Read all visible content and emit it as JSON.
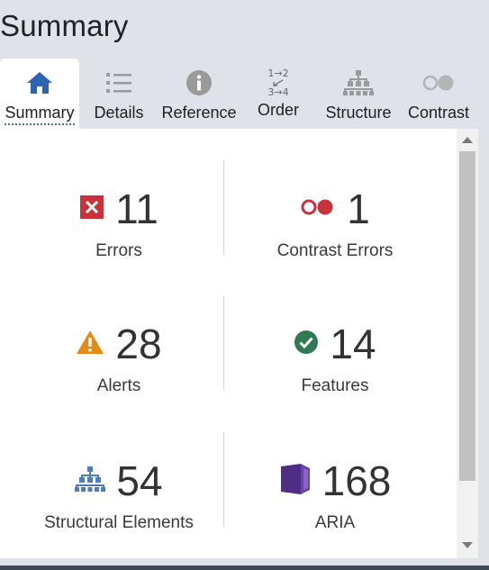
{
  "page_title": "Summary",
  "tabs": [
    {
      "label": "Summary",
      "icon": "home-icon",
      "active": true
    },
    {
      "label": "Details",
      "icon": "list-icon",
      "active": false
    },
    {
      "label": "Reference",
      "icon": "info-icon",
      "active": false
    },
    {
      "label": "Order",
      "icon": "order-icon",
      "active": false
    },
    {
      "label": "Structure",
      "icon": "structure-icon",
      "active": false
    },
    {
      "label": "Contrast",
      "icon": "contrast-icon",
      "active": false
    }
  ],
  "order_icon_text": {
    "top": "1→2",
    "bottom": "3→4"
  },
  "stats": {
    "errors": {
      "value": "11",
      "label": "Errors",
      "icon": "error-icon",
      "color": "#c8323a"
    },
    "contrast_errors": {
      "value": "1",
      "label": "Contrast Errors",
      "icon": "contrast-error-icon",
      "color": "#c8323a"
    },
    "alerts": {
      "value": "28",
      "label": "Alerts",
      "icon": "alert-icon",
      "color": "#e58a14"
    },
    "features": {
      "value": "14",
      "label": "Features",
      "icon": "feature-icon",
      "color": "#2f7a52"
    },
    "structural_elements": {
      "value": "54",
      "label": "Structural Elements",
      "icon": "structure-icon",
      "color": "#4a7dc4"
    },
    "aria": {
      "value": "168",
      "label": "ARIA",
      "icon": "aria-icon",
      "color": "#4f2d84"
    }
  }
}
